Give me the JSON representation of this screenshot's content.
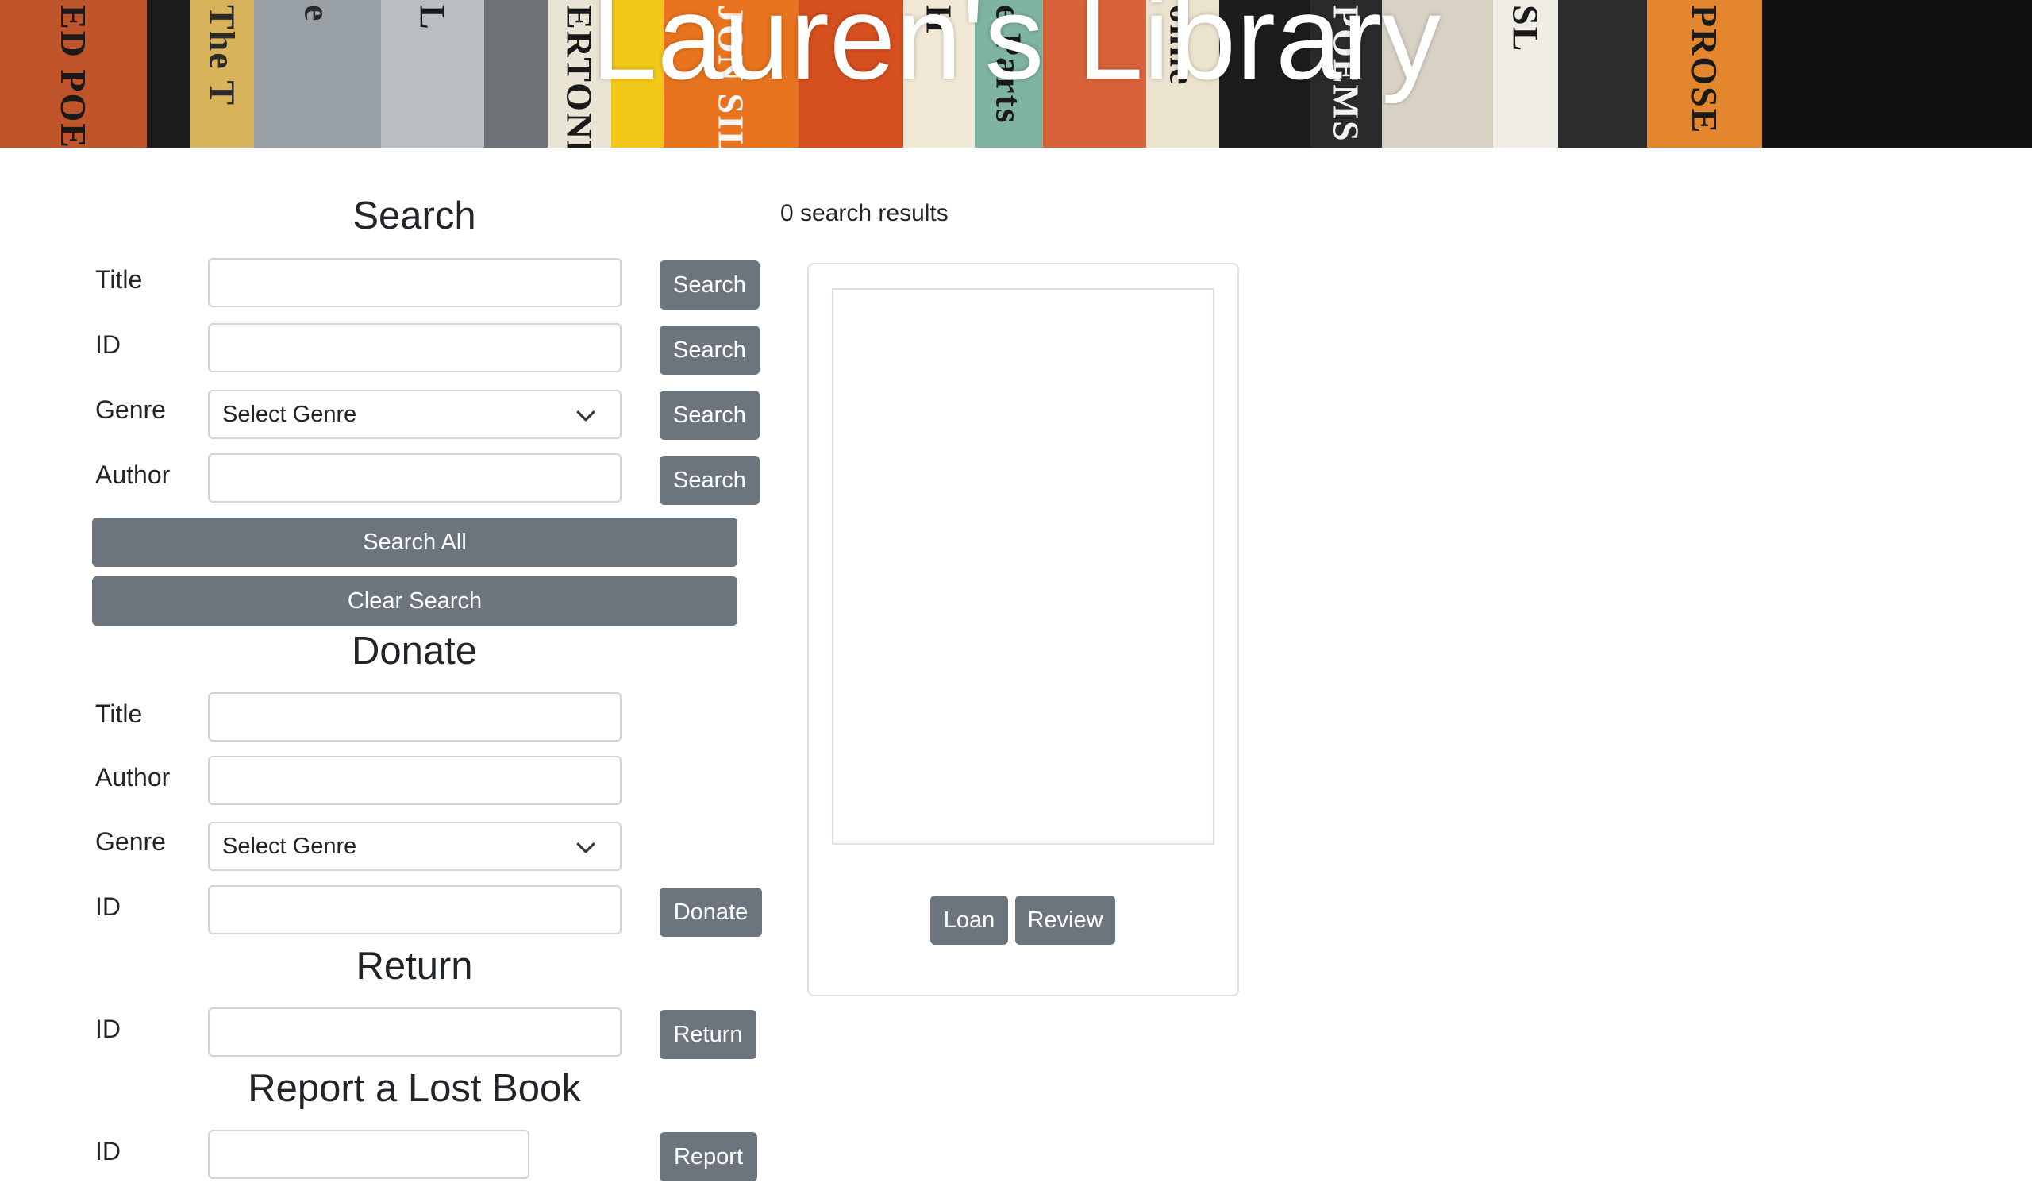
{
  "header": {
    "title": "Lauren's Library",
    "spines": [
      {
        "text": "ED POEM",
        "bg": "#c0552c",
        "fg": "#1a1a1a"
      },
      {
        "text": "",
        "bg": "#1c1c1c",
        "fg": "#e0e0e0"
      },
      {
        "text": "The T",
        "bg": "#d9b35a",
        "fg": "#2a2a2a"
      },
      {
        "text": "e",
        "bg": "#9aa1a6",
        "fg": "#2a2a2a"
      },
      {
        "text": "L",
        "bg": "#b9bec2",
        "fg": "#1a1a1a"
      },
      {
        "text": "",
        "bg": "#6f7377",
        "fg": "#eeeeee"
      },
      {
        "text": "ERTONE",
        "bg": "#e9e4d3",
        "fg": "#1a1a1a"
      },
      {
        "text": "",
        "bg": "#f2c919",
        "fg": "#1a1a1a"
      },
      {
        "text": "JON SILKIN",
        "bg": "#e9741f",
        "fg": "#f5f5f5"
      },
      {
        "text": "",
        "bg": "#d64f1f",
        "fg": "#f5f5f5"
      },
      {
        "text": "H",
        "bg": "#f1e9d6",
        "fg": "#1a1a1a"
      },
      {
        "text": "e Parts",
        "bg": "#7fb3a4",
        "fg": "#1a1a1a"
      },
      {
        "text": "",
        "bg": "#d8633a",
        "fg": "#f5f5f5"
      },
      {
        "text": "onne",
        "bg": "#ece3cf",
        "fg": "#1a1a1a"
      },
      {
        "text": "",
        "bg": "#1c1c1c",
        "fg": "#eeeeee"
      },
      {
        "text": "POEMS",
        "bg": "#2a2a2a",
        "fg": "#f2f2f2"
      },
      {
        "text": "",
        "bg": "#d7d2c4",
        "fg": "#1a1a1a"
      },
      {
        "text": "SL",
        "bg": "#efece4",
        "fg": "#1a1a1a"
      },
      {
        "text": "",
        "bg": "#2d2d2d",
        "fg": "#eeeeee"
      },
      {
        "text": "PROSE",
        "bg": "#e4862d",
        "fg": "#1a1a1a"
      }
    ]
  },
  "search": {
    "heading": "Search",
    "title_label": "Title",
    "id_label": "ID",
    "genre_label": "Genre",
    "author_label": "Author",
    "genre_select": "Select Genre",
    "search_button": "Search",
    "search_all_button": "Search All",
    "clear_button": "Clear Search"
  },
  "donate": {
    "heading": "Donate",
    "title_label": "Title",
    "author_label": "Author",
    "genre_label": "Genre",
    "id_label": "ID",
    "genre_select": "Select Genre",
    "donate_button": "Donate"
  },
  "return_section": {
    "heading": "Return",
    "id_label": "ID",
    "return_button": "Return"
  },
  "report": {
    "heading": "Report a Lost Book",
    "id_label": "ID",
    "report_button": "Report"
  },
  "results": {
    "count_text": "0 search results",
    "loan_button": "Loan",
    "review_button": "Review"
  },
  "colors": {
    "button_bg": "#6c757d",
    "border": "#ced4da"
  }
}
